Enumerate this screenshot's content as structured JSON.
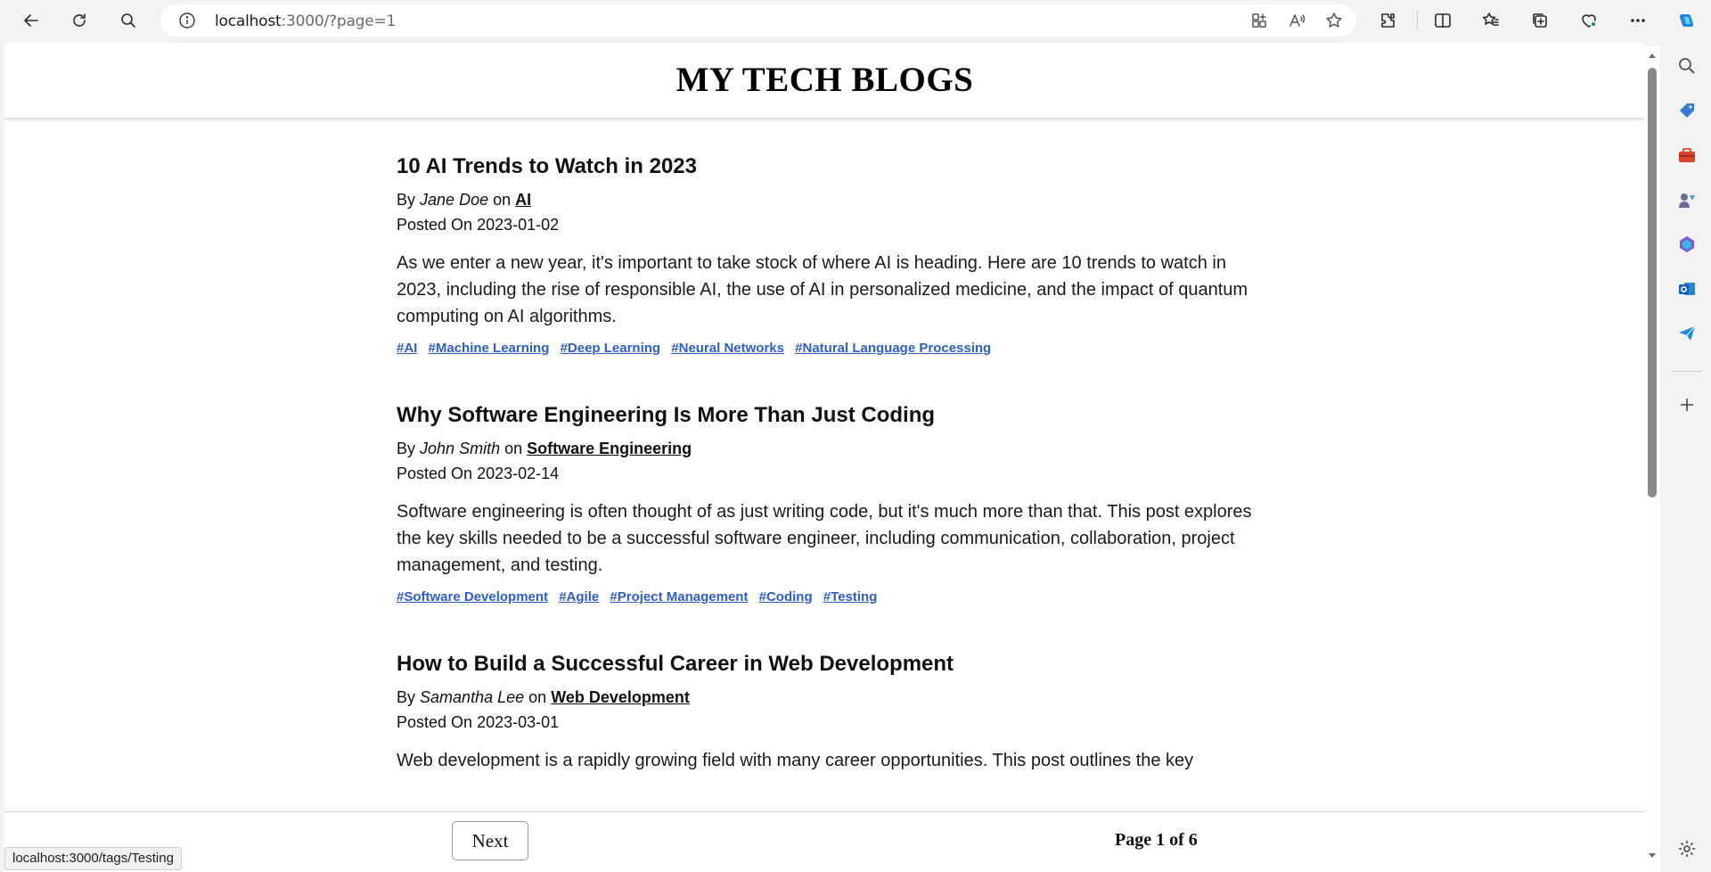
{
  "browser": {
    "url_host": "localhost",
    "url_rest": ":3000/?page=1",
    "status_url": "localhost:3000/tags/Testing"
  },
  "site": {
    "title": "MY TECH BLOGS"
  },
  "posts": [
    {
      "title": "10 AI Trends to Watch in 2023",
      "by": "By",
      "author": "Jane Doe",
      "on": "on",
      "category": "AI",
      "posted_label": "Posted On",
      "date": "2023-01-02",
      "excerpt": "As we enter a new year, it's important to take stock of where AI is heading. Here are 10 trends to watch in 2023, including the rise of responsible AI, the use of AI in personalized medicine, and the impact of quantum computing on AI algorithms.",
      "tags": [
        "#AI",
        "#Machine Learning",
        "#Deep Learning",
        "#Neural Networks",
        "#Natural Language Processing"
      ]
    },
    {
      "title": "Why Software Engineering Is More Than Just Coding",
      "by": "By",
      "author": "John Smith",
      "on": "on",
      "category": "Software Engineering",
      "posted_label": "Posted On",
      "date": "2023-02-14",
      "excerpt": "Software engineering is often thought of as just writing code, but it's much more than that. This post explores the key skills needed to be a successful software engineer, including communication, collaboration, project management, and testing.",
      "tags": [
        "#Software Development",
        "#Agile",
        "#Project Management",
        "#Coding",
        "#Testing"
      ]
    },
    {
      "title": "How to Build a Successful Career in Web Development",
      "by": "By",
      "author": "Samantha Lee",
      "on": "on",
      "category": "Web Development",
      "posted_label": "Posted On",
      "date": "2023-03-01",
      "excerpt": "Web development is a rapidly growing field with many career opportunities. This post outlines the key",
      "tags": []
    }
  ],
  "pagination": {
    "next_label": "Next",
    "page_info": "Page 1 of 6"
  },
  "icons": {
    "back": "back-arrow-icon",
    "refresh": "refresh-icon",
    "search": "search-icon",
    "info": "info-icon",
    "accent": "#2f5fc4"
  }
}
